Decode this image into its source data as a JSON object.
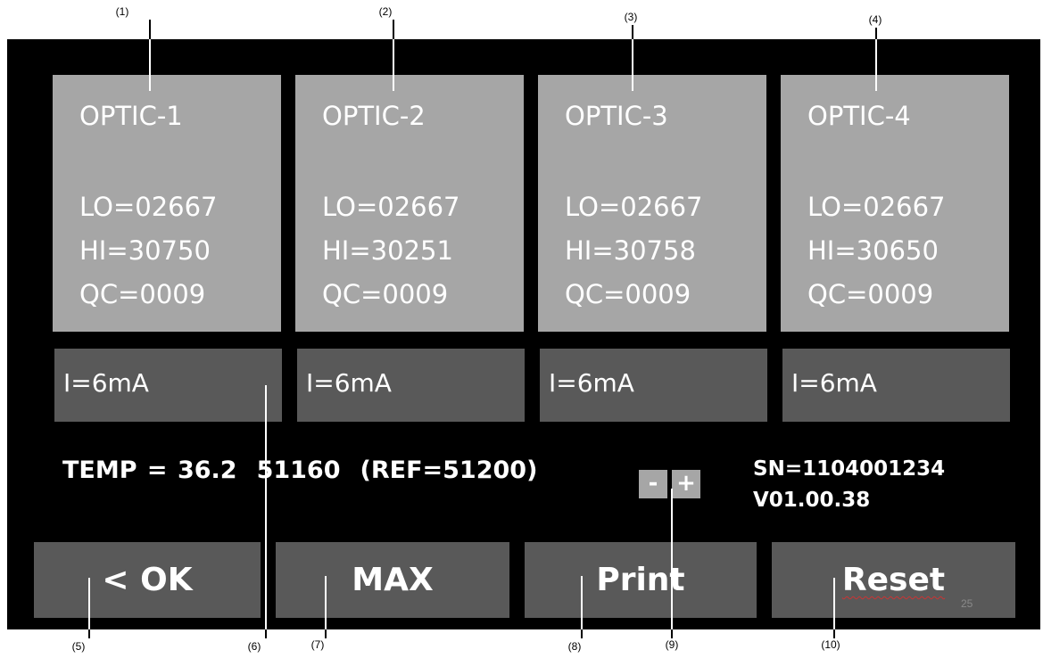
{
  "callouts": {
    "c1": "(1)",
    "c2": "(2)",
    "c3": "(3)",
    "c4": "(4)",
    "c5": "(5)",
    "c6": "(6)",
    "c7": "(7)",
    "c8": "(8)",
    "c9": "(9)",
    "c10": "(10)"
  },
  "optics": [
    {
      "name": "OPTIC-1",
      "lo": "LO=02667",
      "hi": "HI=30750",
      "qc": "QC=0009",
      "current": "I=6mA"
    },
    {
      "name": "OPTIC-2",
      "lo": "LO=02667",
      "hi": "HI=30251",
      "qc": "QC=0009",
      "current": "I=6mA"
    },
    {
      "name": "OPTIC-3",
      "lo": "LO=02667",
      "hi": "HI=30758",
      "qc": "QC=0009",
      "current": "I=6mA"
    },
    {
      "name": "OPTIC-4",
      "lo": "LO=02667",
      "hi": "HI=30650",
      "qc": "QC=0009",
      "current": "I=6mA"
    }
  ],
  "status": {
    "temp": "TEMP = 36.2",
    "reading": "51160",
    "ref": "(REF=51200)",
    "minus_label": "-",
    "plus_label": "+",
    "serial": "SN=1104001234",
    "version": "V01.00.38"
  },
  "buttons": {
    "ok": "< OK",
    "max": "MAX",
    "print": "Print",
    "reset": "Reset"
  },
  "page_number": "25",
  "colors": {
    "panel_bg": "#000000",
    "optic_tile": "#a6a6a6",
    "button_bg": "#595959",
    "text": "#ffffff"
  }
}
